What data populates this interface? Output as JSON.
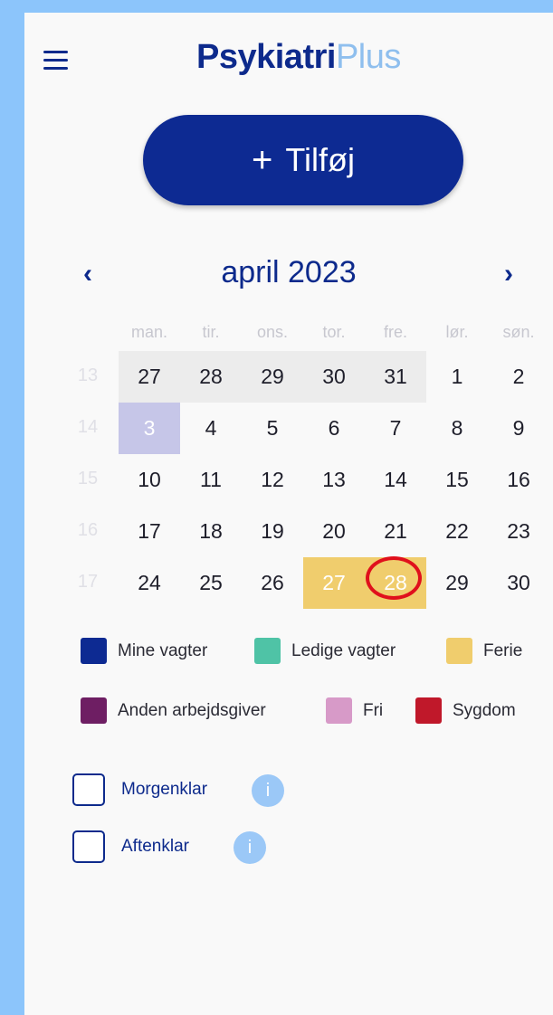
{
  "header": {
    "logo_part1": "Psykiatri",
    "logo_part2": "Plus",
    "menu_icon": "hamburger-icon"
  },
  "add_button": {
    "plus": "+",
    "label": "Tilføj"
  },
  "calendar": {
    "title": "april 2023",
    "prev": "‹",
    "next": "›",
    "weekdays": [
      "man.",
      "tir.",
      "ons.",
      "tor.",
      "fre.",
      "lør.",
      "søn."
    ],
    "weeks": [
      {
        "num": "13",
        "days": [
          "27",
          "28",
          "29",
          "30",
          "31",
          "1",
          "2"
        ]
      },
      {
        "num": "14",
        "days": [
          "3",
          "4",
          "5",
          "6",
          "7",
          "8",
          "9"
        ]
      },
      {
        "num": "15",
        "days": [
          "10",
          "11",
          "12",
          "13",
          "14",
          "15",
          "16"
        ]
      },
      {
        "num": "16",
        "days": [
          "17",
          "18",
          "19",
          "20",
          "21",
          "22",
          "23"
        ]
      },
      {
        "num": "17",
        "days": [
          "24",
          "25",
          "26",
          "27",
          "28",
          "29",
          "30"
        ]
      }
    ],
    "colors": {
      "grey": "#ececec",
      "lavender": "#c6c6e8",
      "ferie": "#f0cd6d",
      "highlight_circle": "#e0101c"
    }
  },
  "legend": [
    {
      "label": "Mine vagter",
      "color": "#0d2a92"
    },
    {
      "label": "Ledige vagter",
      "color": "#4fc3a6"
    },
    {
      "label": "Ferie",
      "color": "#f0cd6d"
    },
    {
      "label": "Anden arbejdsgiver",
      "color": "#6e1e63"
    },
    {
      "label": "Fri",
      "color": "#d79ac8"
    },
    {
      "label": "Sygdom",
      "color": "#c0182a"
    }
  ],
  "options": [
    {
      "label": "Morgenklar",
      "info": "i"
    },
    {
      "label": "Aftenklar",
      "info": "i"
    }
  ]
}
